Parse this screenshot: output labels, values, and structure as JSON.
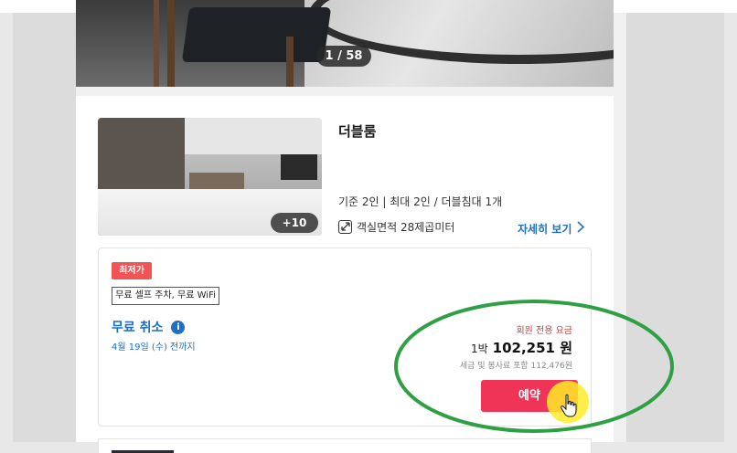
{
  "gallery": {
    "counter": "1 / 58"
  },
  "room": {
    "name": "더블룸",
    "photo_count": "+10",
    "capacity": "기준 2인 | 최대 2인 / 더블침대 1개",
    "area": "객실면적 28제곱미터",
    "detail_link": "자세히 보기"
  },
  "rate": {
    "badge": "최저가",
    "amenities": "무료 셀프 주차, 무료 WiFi",
    "cancel_title": "무료 취소",
    "cancel_date": "4월 19일 (수) 전까지",
    "member_rate": "회원 전용 요금",
    "nights": "1박",
    "price": "102,251 원",
    "tax_note": "세금 및 봉사료 포함 112,476원",
    "reserve_label": "예약"
  },
  "icons": {
    "info": "info-icon",
    "area": "area-icon",
    "chevron": "chevron-right-icon",
    "cursor": "hand-cursor-icon"
  },
  "colors": {
    "accent_blue": "#1f6fc2",
    "reserve_red": "#ef3457",
    "badge_red": "#f05454",
    "annotation_green": "#2ea043",
    "cursor_yellow": "#ffec28"
  }
}
